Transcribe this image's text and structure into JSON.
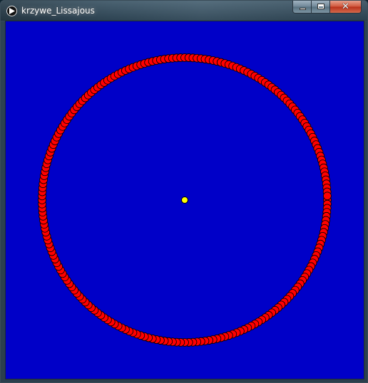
{
  "window": {
    "title": "krzywe_Lissajous",
    "app_icon": "play-icon",
    "controls": {
      "minimize_icon": "minimize-icon",
      "maximize_icon": "maximize-icon",
      "close_icon": "close-icon",
      "close_glyph": "✕"
    }
  },
  "sketch": {
    "background_color": "#0000c8",
    "curve": {
      "kind": "circle",
      "dot_count": 220,
      "dot_color": "#ff0000",
      "dot_outline": "#000000"
    },
    "center_point": {
      "color": "#ffff00",
      "outline": "#000000"
    }
  }
}
